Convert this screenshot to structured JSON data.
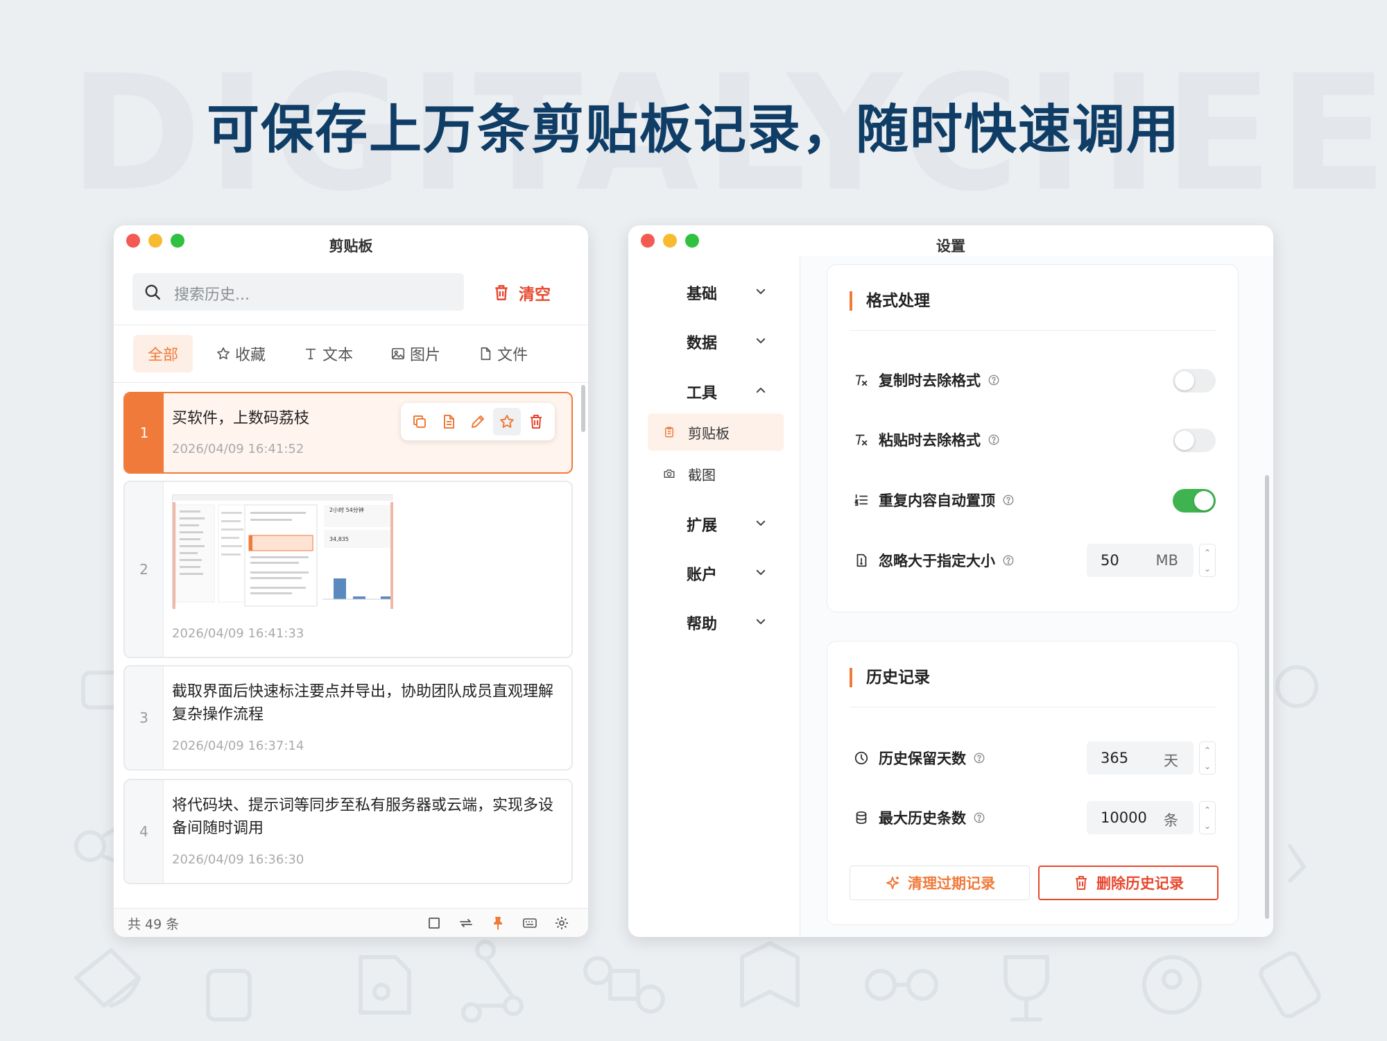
{
  "watermark": "DIGITALYCHEE",
  "headline": "可保存上万条剪贴板记录，随时快速调用",
  "colors": {
    "accent": "#f07a3a",
    "danger": "#e8472e",
    "toggle_on": "#3fb34f",
    "headline": "#0f3d66"
  },
  "clipboard_window": {
    "title": "剪贴板",
    "search_placeholder": "搜索历史...",
    "clear_label": "清空",
    "tabs": [
      {
        "label": "全部",
        "icon": "none"
      },
      {
        "label": "收藏",
        "icon": "star-icon"
      },
      {
        "label": "文本",
        "icon": "text-icon"
      },
      {
        "label": "图片",
        "icon": "image-icon"
      },
      {
        "label": "文件",
        "icon": "file-icon"
      }
    ],
    "items": [
      {
        "index": "1",
        "text": "买软件，上数码荔枝",
        "time": "2026/04/09 16:41:52"
      },
      {
        "index": "2",
        "type": "image",
        "time": "2026/04/09 16:41:33"
      },
      {
        "index": "3",
        "text": "截取界面后快速标注要点并导出，协助团队成员直观理解复杂操作流程",
        "time": "2026/04/09 16:37:14"
      },
      {
        "index": "4",
        "text": "将代码块、提示词等同步至私有服务器或云端，实现多设备间随时调用",
        "time": "2026/04/09 16:36:30"
      }
    ],
    "thumbnail": {
      "stat1": "2小时 54分钟",
      "stat2": "34,835"
    },
    "footer_count": "共 49 条"
  },
  "settings_window": {
    "title": "设置",
    "nav": [
      {
        "label": "基础",
        "expanded": false
      },
      {
        "label": "数据",
        "expanded": false
      },
      {
        "label": "工具",
        "expanded": true
      },
      {
        "label": "扩展",
        "expanded": false
      },
      {
        "label": "账户",
        "expanded": false
      },
      {
        "label": "帮助",
        "expanded": false
      }
    ],
    "subnav": [
      {
        "label": "剪贴板",
        "active": true
      },
      {
        "label": "截图",
        "active": false
      }
    ],
    "format_section": {
      "title": "格式处理",
      "rows": [
        {
          "label": "复制时去除格式",
          "enabled": false
        },
        {
          "label": "粘贴时去除格式",
          "enabled": false
        },
        {
          "label": "重复内容自动置顶",
          "enabled": true
        }
      ],
      "size_limit": {
        "label": "忽略大于指定大小",
        "value": "50",
        "unit": "MB"
      }
    },
    "history_section": {
      "title": "历史记录",
      "retention": {
        "label": "历史保留天数",
        "value": "365",
        "unit": "天"
      },
      "max_count": {
        "label": "最大历史条数",
        "value": "10000",
        "unit": "条"
      },
      "clean_button": "清理过期记录",
      "delete_button": "删除历史记录"
    }
  }
}
